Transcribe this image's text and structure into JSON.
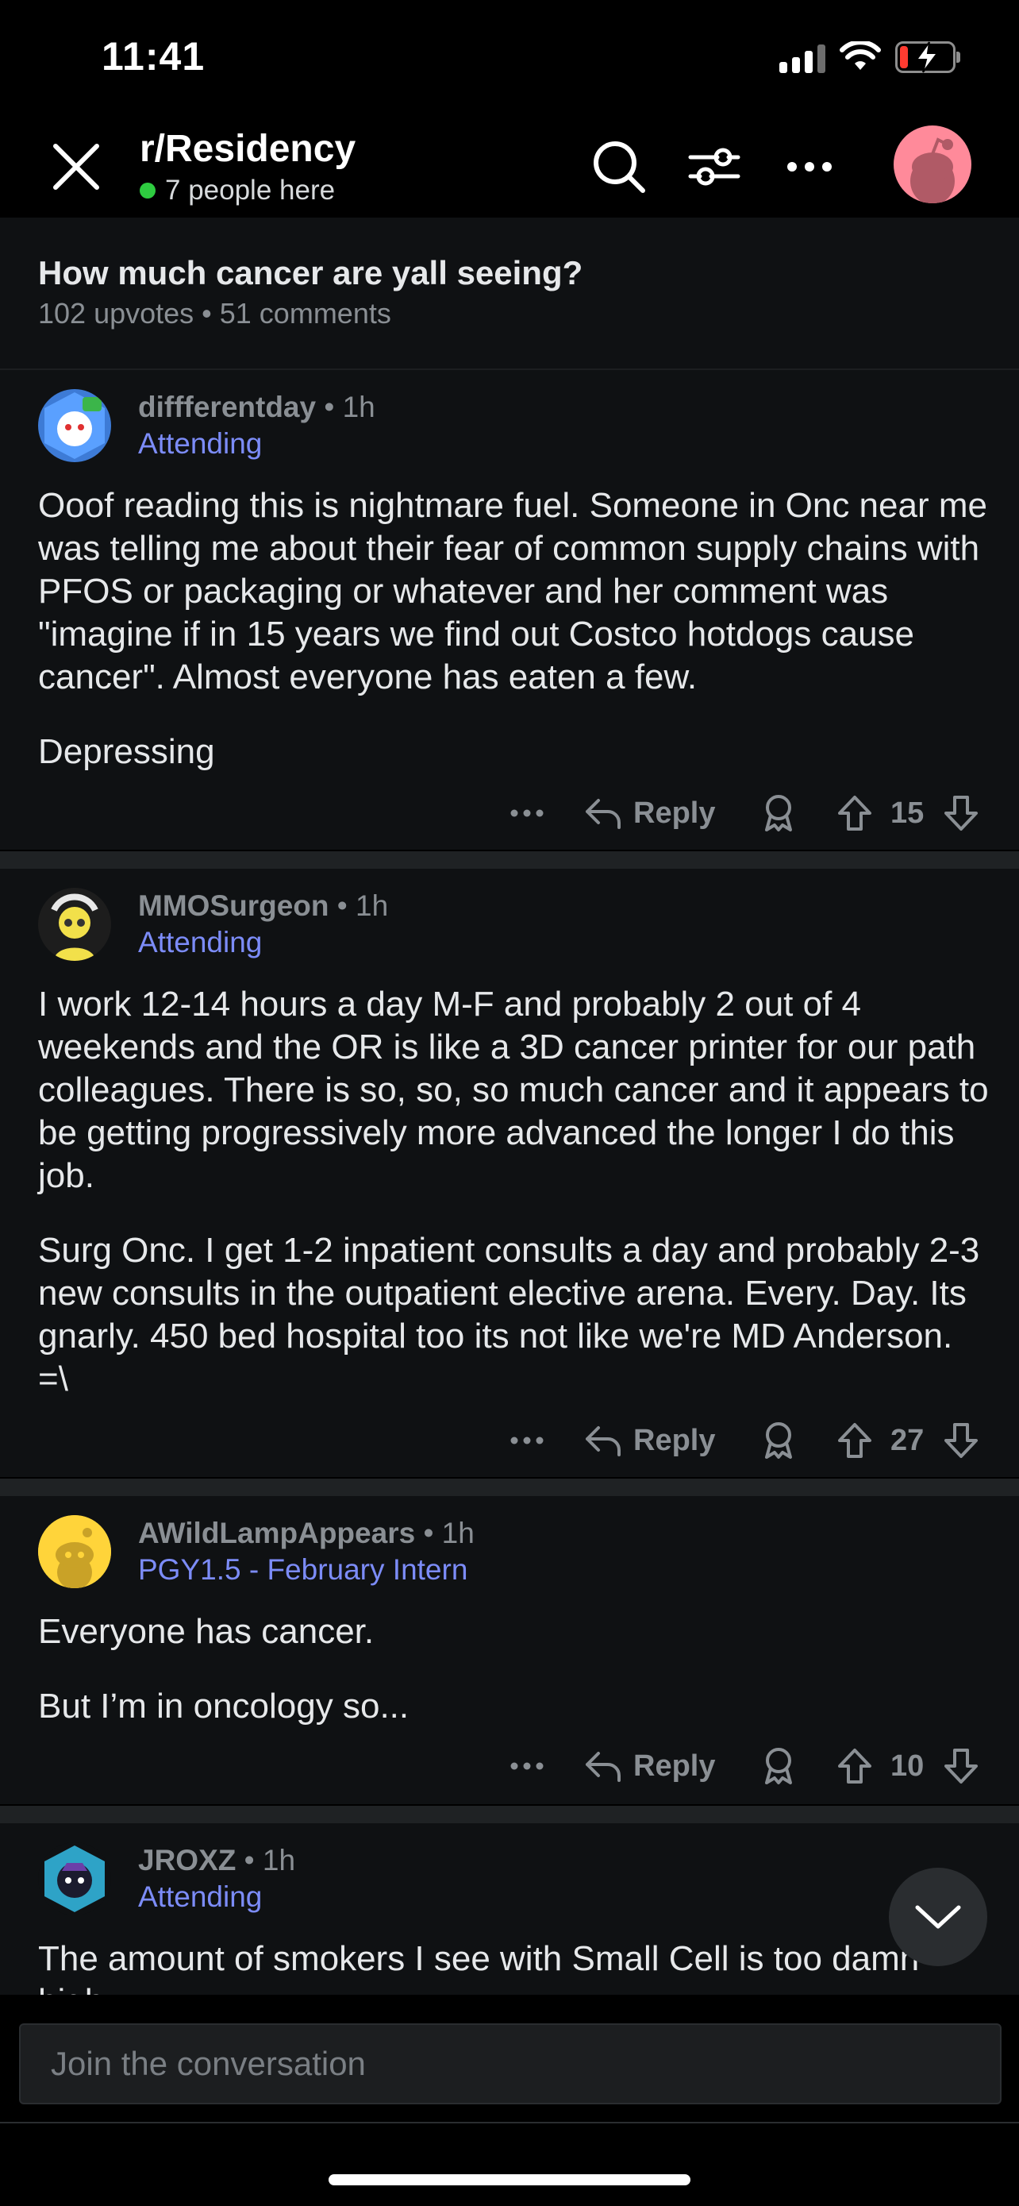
{
  "status_bar": {
    "time": "11:41"
  },
  "nav": {
    "subreddit": "r/Residency",
    "online_text": "7 people here",
    "icons": [
      "close-icon",
      "search-icon",
      "sort-filter-icon",
      "more-icon",
      "avatar"
    ]
  },
  "post": {
    "title": "How much cancer are yall seeing?",
    "meta": "102 upvotes • 51 comments"
  },
  "comments": [
    {
      "user": "diffferentday",
      "time": "• 1h",
      "flair": "Attending",
      "body": [
        "Ooof reading this is nightmare fuel. Someone in Onc near me was telling me about their fear of common supply chains with PFOS or packaging or whatever and her comment was \"imagine if in 15 years we find out Costco hotdogs cause cancer\". Almost everyone has eaten a few.",
        "Depressing"
      ],
      "reply_label": "Reply",
      "votes": "15"
    },
    {
      "user": "MMOSurgeon",
      "time": "• 1h",
      "flair": "Attending",
      "body": [
        "I work 12-14 hours a day M-F and probably 2 out of 4 weekends and the OR is like a 3D cancer printer for our path colleagues. There is so, so, so much cancer and it appears to be getting progressively more advanced the longer I do this job.",
        "Surg Onc. I get 1-2 inpatient consults a day and probably 2-3 new consults in the outpatient elective arena. Every. Day. Its gnarly. 450 bed hospital too its not like we're MD Anderson. =\\"
      ],
      "reply_label": "Reply",
      "votes": "27"
    },
    {
      "user": "AWildLampAppears",
      "time": "• 1h",
      "flair": "PGY1.5 - February Intern",
      "body": [
        "Everyone has cancer.",
        "But I’m in oncology so..."
      ],
      "reply_label": "Reply",
      "votes": "10"
    },
    {
      "user": "JROXZ",
      "time": "• 1h",
      "flair": "Attending",
      "body": [
        "The amount of smokers I see with Small Cell is too damn high"
      ]
    }
  ],
  "composer": {
    "placeholder": "Join the conversation"
  },
  "colors": {
    "flair": "#7c8cf8",
    "online": "#2ecc40",
    "avatar_bg": "#ff8a9a"
  }
}
